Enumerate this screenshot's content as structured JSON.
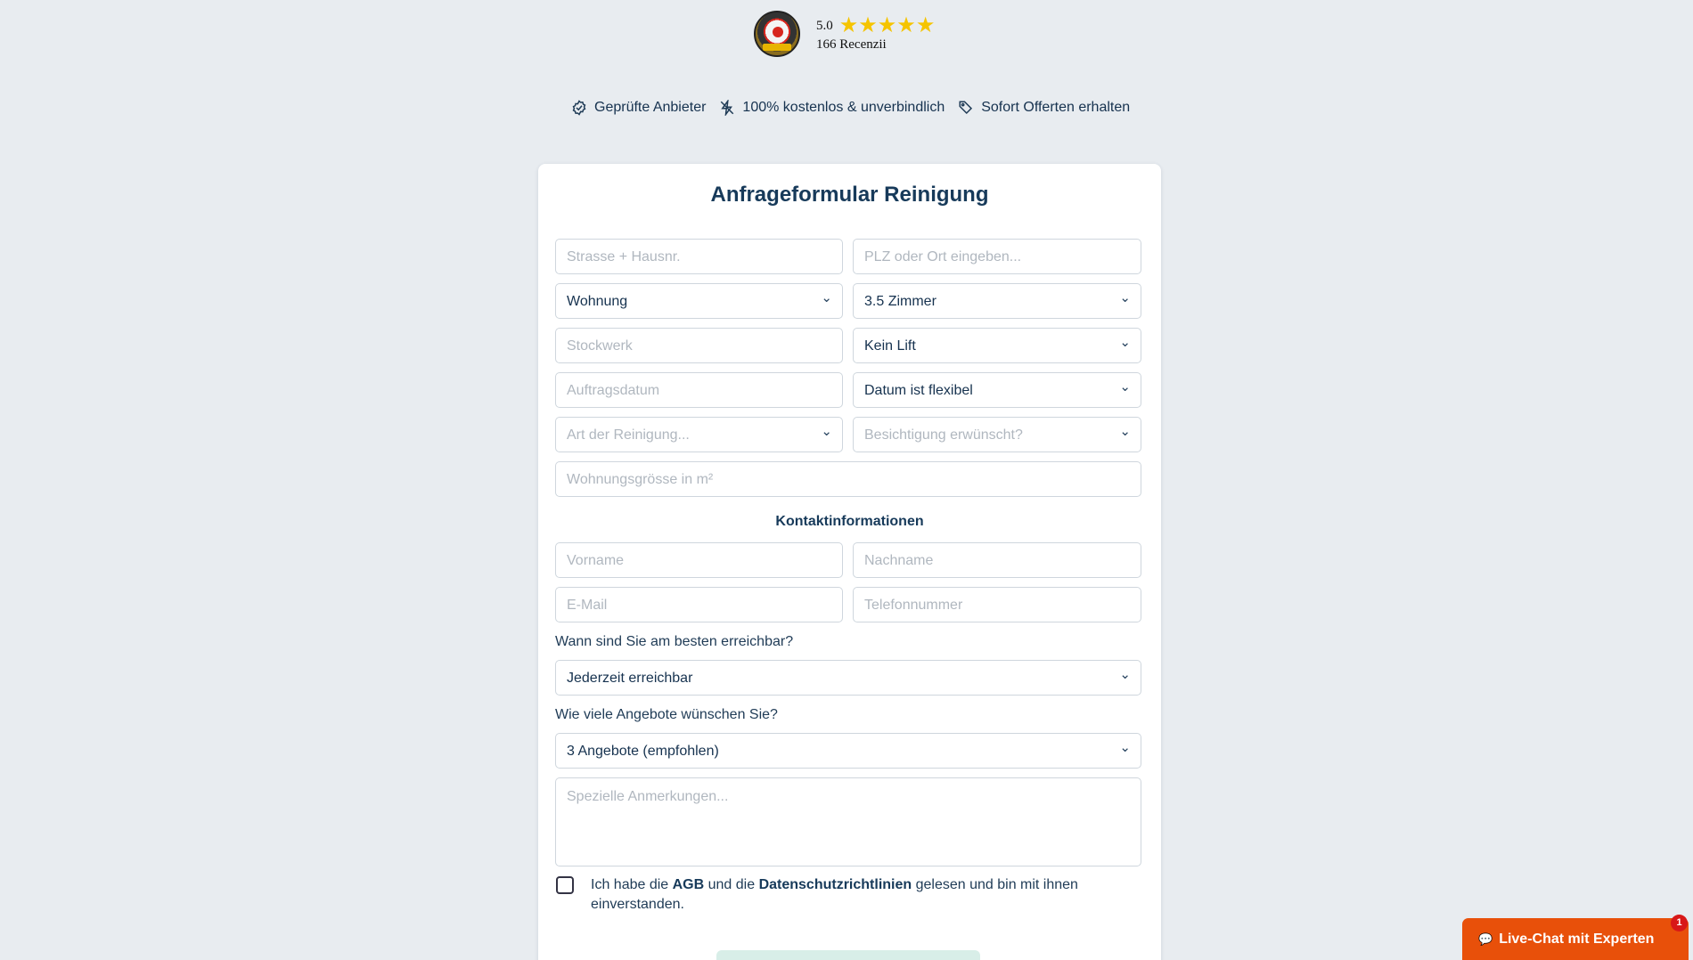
{
  "rating": {
    "score": "5.0",
    "stars": "★★★★★",
    "reviews": "166 Recenzii"
  },
  "features": [
    {
      "label": "Geprüfte Anbieter",
      "icon": "badge-check-icon"
    },
    {
      "label": "100% kostenlos & unverbindlich",
      "icon": "no-cost-icon"
    },
    {
      "label": "Sofort Offerten erhalten",
      "icon": "tag-icon"
    }
  ],
  "form": {
    "title": "Anfrageformular Reinigung",
    "street_placeholder": "Strasse + Hausnr.",
    "location_placeholder": "PLZ oder Ort eingeben...",
    "property_type": "Wohnung",
    "rooms": "3.5 Zimmer",
    "floor_placeholder": "Stockwerk",
    "lift": "Kein Lift",
    "date_placeholder": "Auftragsdatum",
    "date_flexibility": "Datum ist flexibel",
    "cleaning_type": "Art der Reinigung...",
    "inspection": "Besichtigung erwünscht?",
    "size_placeholder": "Wohnungsgrösse in m²",
    "contact_title": "Kontaktinformationen",
    "firstname_placeholder": "Vorname",
    "lastname_placeholder": "Nachname",
    "email_placeholder": "E-Mail",
    "phone_placeholder": "Telefonnummer",
    "availability_question": "Wann sind Sie am besten erreichbar?",
    "availability": "Jederzeit erreichbar",
    "offers_question": "Wie viele Angebote wünschen Sie?",
    "offers": "3 Angebote (empfohlen)",
    "notes_placeholder": "Spezielle Anmerkungen...",
    "agree_prefix": "Ich habe die ",
    "agb": "AGB",
    "agree_middle": " und die ",
    "privacy": "Datenschutzrichtlinien",
    "agree_suffix": " gelesen und bin mit ihnen einverstanden."
  },
  "chat": {
    "label": "Live-Chat mit Experten",
    "notification_count": "1"
  },
  "colors": {
    "background": "#e8ecf0",
    "heading": "#173a5a",
    "chat": "#e8500a",
    "stars": "#f5c400"
  }
}
